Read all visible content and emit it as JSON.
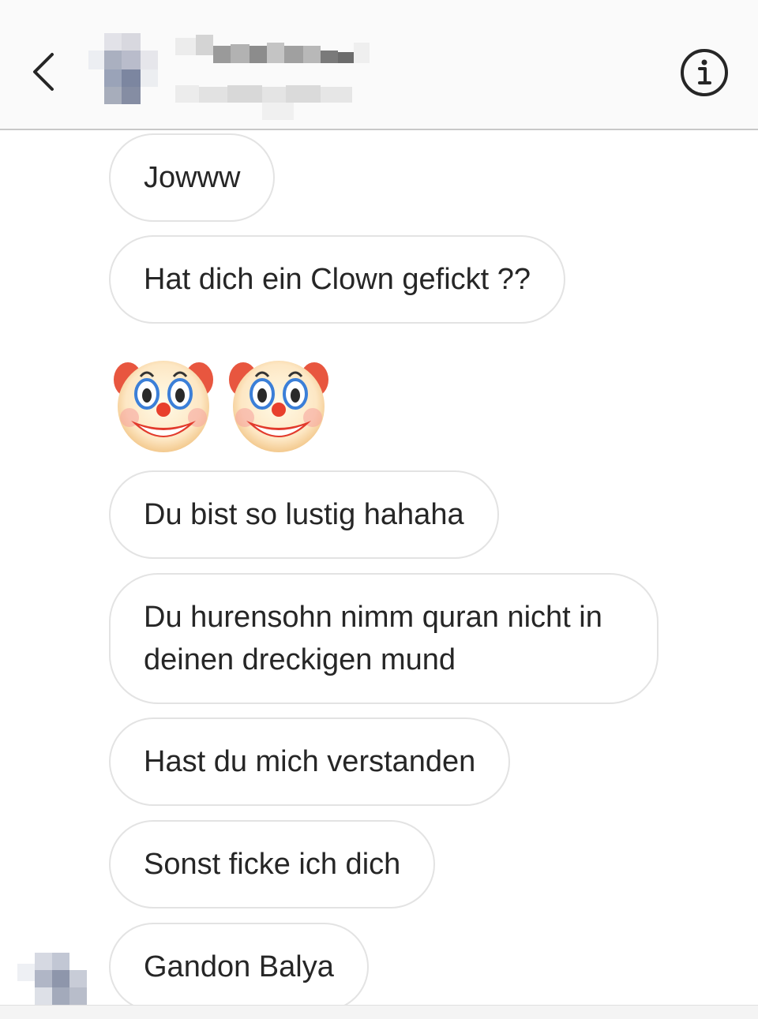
{
  "header": {
    "back_icon": "chevron-left-icon",
    "avatar": "blurred",
    "username": "",
    "subtitle": "",
    "info_icon": "info-circle-icon"
  },
  "messages": [
    {
      "text": "Jowww"
    },
    {
      "text": "Hat dich ein Clown gefickt ??"
    },
    {
      "emoji": [
        "clown-face-emoji",
        "clown-face-emoji"
      ]
    },
    {
      "text": "Du bist so lustig hahaha"
    },
    {
      "text": "Du hurensohn nimm quran nicht in deinen dreckigen mund"
    },
    {
      "text": "Hast du mich verstanden"
    },
    {
      "text": "Sonst ficke ich dich"
    },
    {
      "text": "Gandon Balya"
    }
  ],
  "colors": {
    "header_bg": "#fafafa",
    "bubble_border": "#e3e3e3",
    "text": "#262626"
  }
}
